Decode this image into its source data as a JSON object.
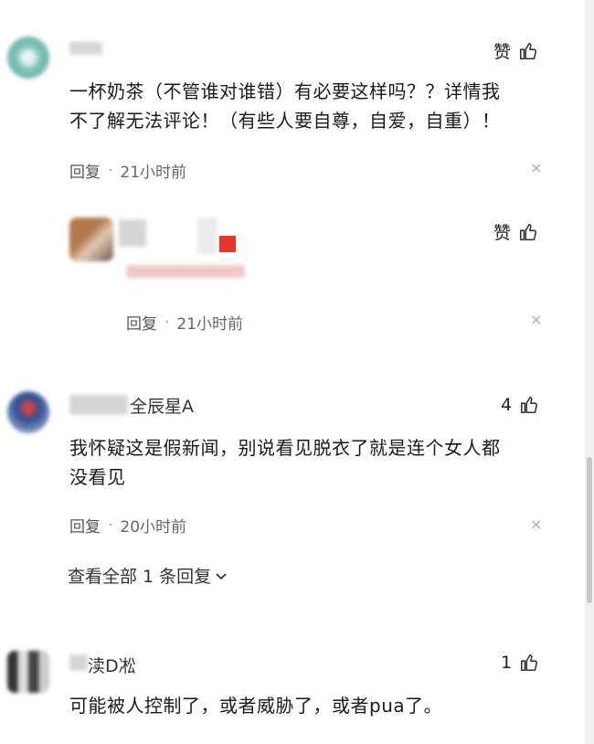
{
  "comments": [
    {
      "name": "",
      "like_label": "赞",
      "content_lines": [
        "一杯奶茶（不管谁对谁错）有必要这样吗？？详情我",
        "不了解无法评论！（有些人要自尊，自爱，自重）！"
      ],
      "reply_label": "回复",
      "dot": "·",
      "time": "21小时前",
      "close": "×"
    },
    {
      "name": "",
      "like_label": "赞",
      "reply_label": "回复",
      "dot": "·",
      "time": "21小时前",
      "close": "×"
    },
    {
      "name": "全辰星A",
      "like_count": "4",
      "content_lines": [
        "我怀疑这是假新闻，别说看见脱衣了就是连个女人都",
        "没看见"
      ],
      "reply_label": "回复",
      "dot": "·",
      "time": "20小时前",
      "close": "×",
      "view_all": "查看全部 1 条回复"
    },
    {
      "name": "渎D凇",
      "like_count": "1",
      "content_lines": [
        "可能被人控制了，或者威胁了，或者pua了。"
      ]
    }
  ],
  "colors": {
    "red_badge": "#e8342a",
    "text": "#1a1a1a",
    "muted": "#666666"
  }
}
